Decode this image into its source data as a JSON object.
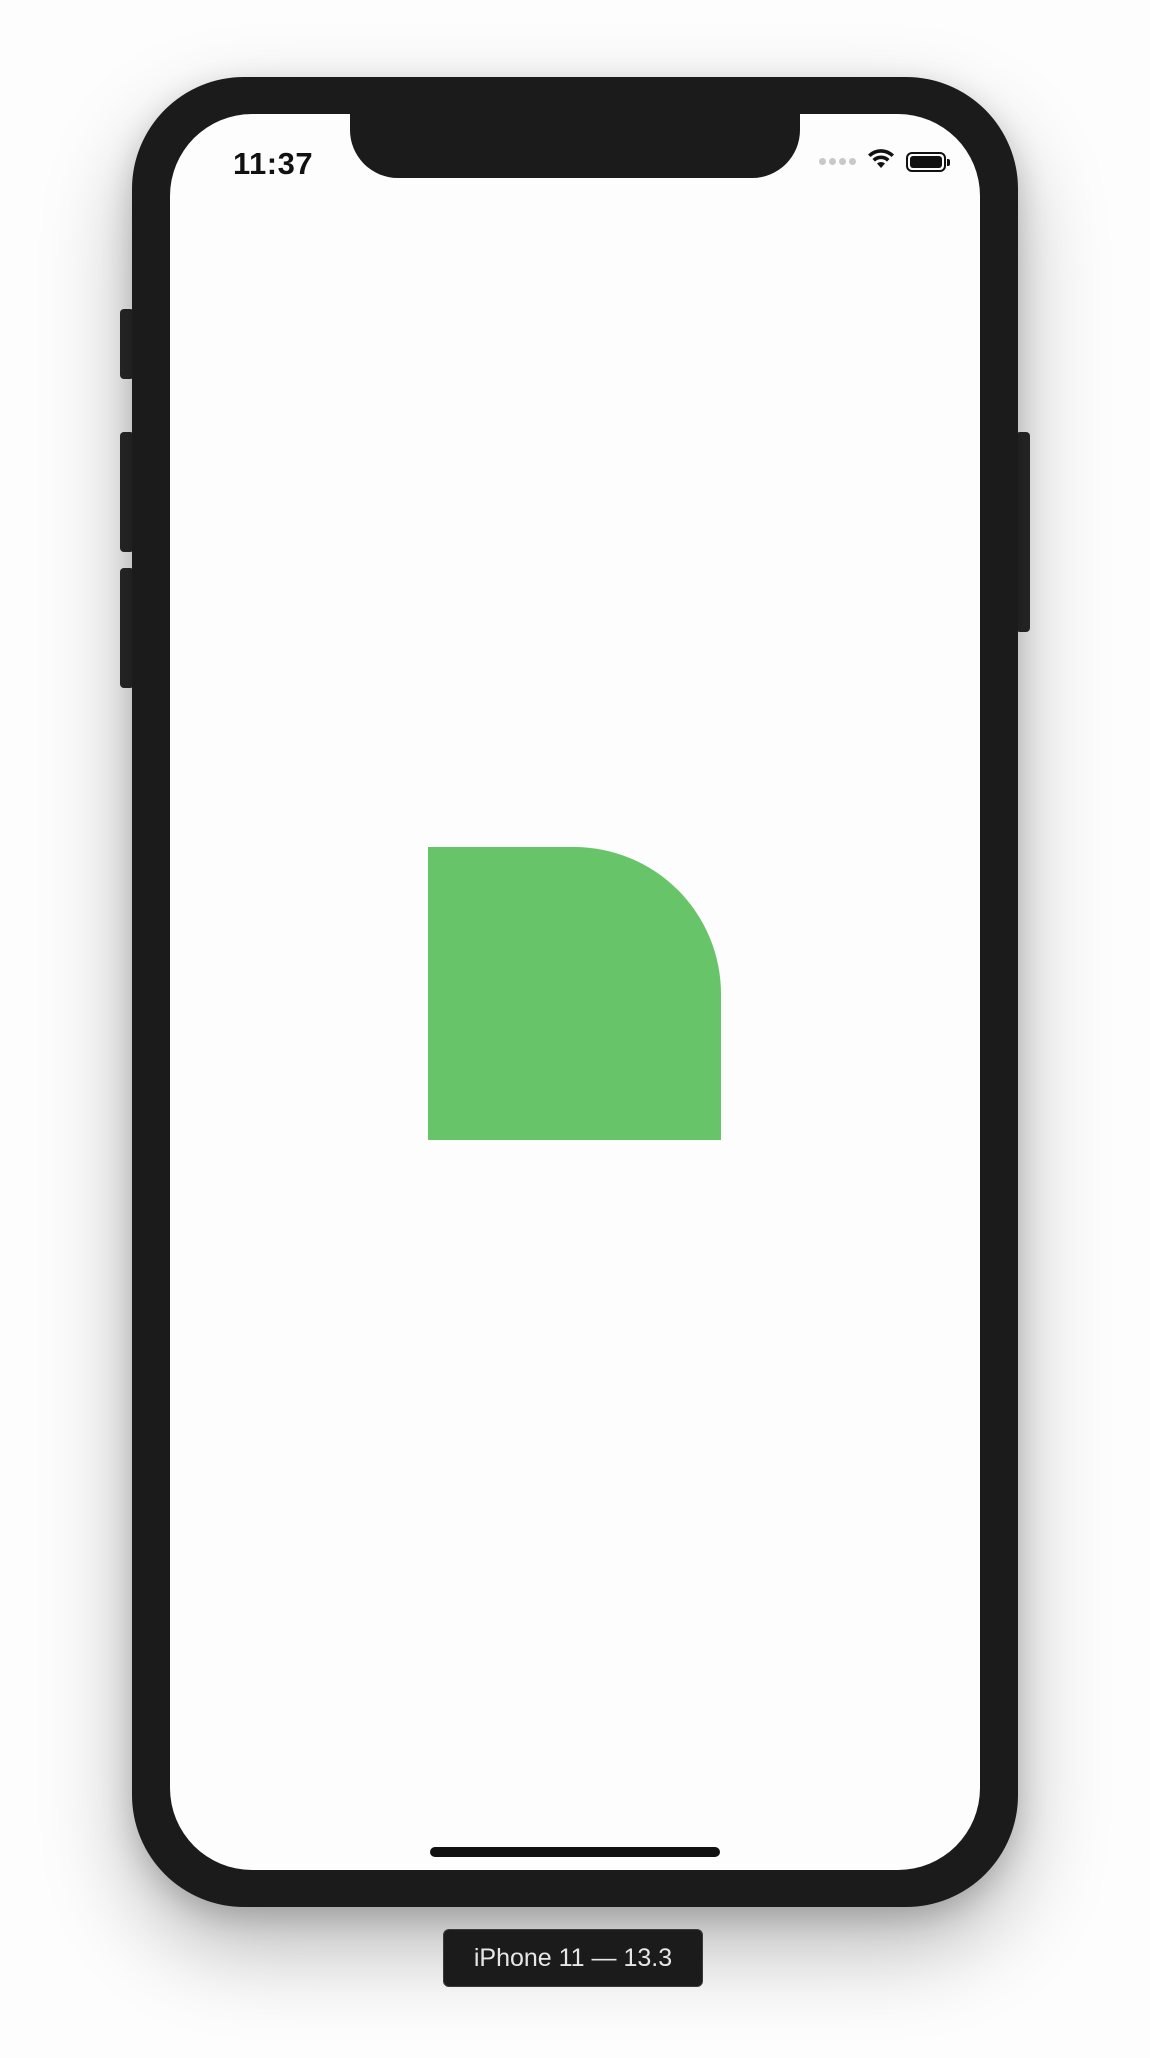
{
  "status_bar": {
    "time": "11:37",
    "icons": [
      "signal-dots-icon",
      "wifi-icon",
      "battery-icon"
    ]
  },
  "canvas": {
    "shape_color": "#68c468",
    "shape_description_name": "green-quarter-rounded-square"
  },
  "device": {
    "label": "iPhone 11 — 13.3",
    "frame_color": "#1b1b1b",
    "screen_color": "#fdfdfd"
  }
}
